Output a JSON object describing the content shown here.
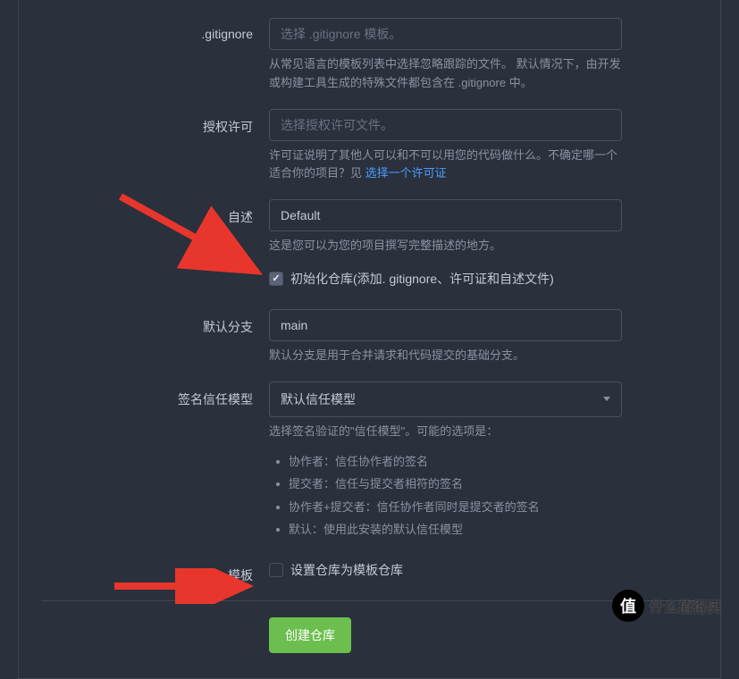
{
  "gitignore": {
    "label": ".gitignore",
    "placeholder": "选择 .gitignore 模板。",
    "help": "从常见语言的模板列表中选择忽略跟踪的文件。 默认情况下，由开发或构建工具生成的特殊文件都包含在 .gitignore 中。"
  },
  "license": {
    "label": "授权许可",
    "placeholder": "选择授权许可文件。",
    "help_prefix": "许可证说明了其他人可以和不可以用您的代码做什么。不确定哪一个适合你的项目？见 ",
    "help_link": "选择一个许可证"
  },
  "readme": {
    "label": "自述",
    "value": "Default",
    "help": "这是您可以为您的项目撰写完整描述的地方。"
  },
  "init_repo": {
    "checked": true,
    "label": "初始化仓库(添加. gitignore、许可证和自述文件)"
  },
  "default_branch": {
    "label": "默认分支",
    "value": "main",
    "help": "默认分支是用于合并请求和代码提交的基础分支。"
  },
  "trust_model": {
    "label": "签名信任模型",
    "value": "默认信任模型",
    "help": "选择签名验证的\"信任模型\"。可能的选项是：",
    "options": [
      "协作者：信任协作者的签名",
      "提交者：信任与提交者相符的签名",
      "协作者+提交者：信任协作者同时是提交者的签名",
      "默认：使用此安装的默认信任模型"
    ]
  },
  "template": {
    "label": "模板",
    "checkbox_label": "设置仓库为模板仓库",
    "checked": false
  },
  "submit": {
    "label": "创建仓库"
  },
  "watermark": {
    "icon": "值",
    "text": "什么值得买"
  }
}
